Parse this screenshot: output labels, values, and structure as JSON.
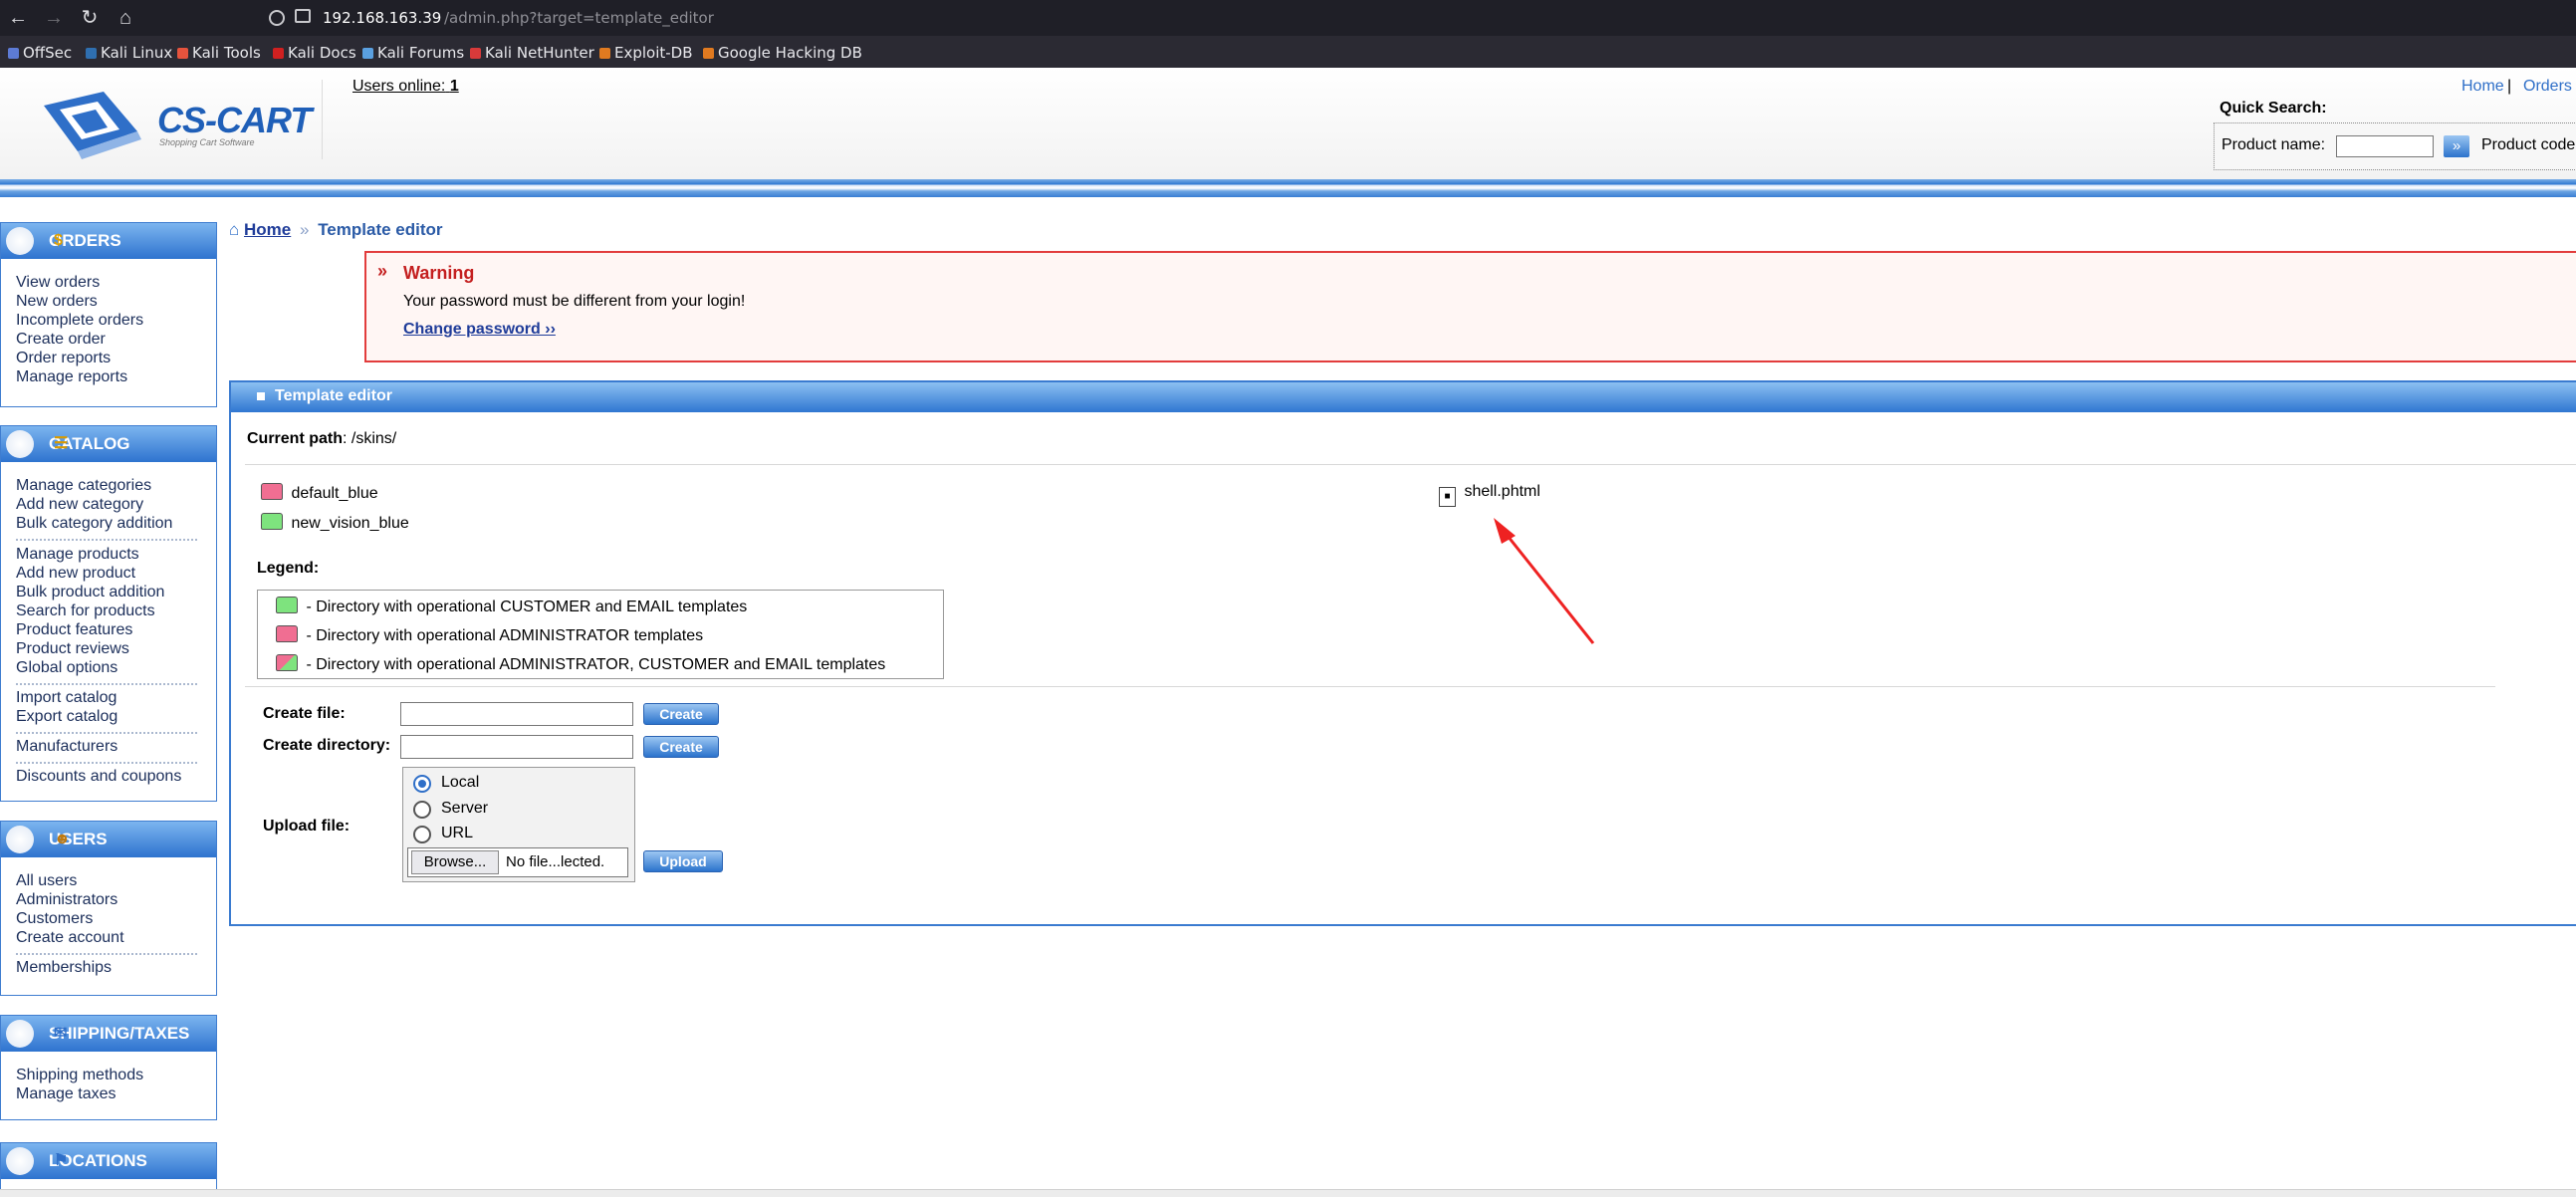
{
  "browser": {
    "url_host": "192.168.163.39",
    "url_path": "/admin.php?target=template_editor",
    "bookmarks": [
      "OffSec",
      "Kali Linux",
      "Kali Tools",
      "Kali Docs",
      "Kali Forums",
      "Kali NetHunter",
      "Exploit-DB",
      "Google Hacking DB"
    ]
  },
  "header": {
    "logo_text": "CS-CART",
    "logo_sub": "Shopping Cart Software",
    "users_online_label": "Users online:",
    "users_online_count": "1",
    "top_links": [
      "Home",
      "|",
      "Orders"
    ],
    "quick_search_title": "Quick Search:",
    "product_name_label": "Product name:",
    "product_code_label": "Product code"
  },
  "sidebar": {
    "orders": {
      "title": "ORDERS",
      "items": [
        "View orders",
        "New orders",
        "Incomplete orders",
        "Create order",
        "Order reports",
        "Manage reports"
      ]
    },
    "catalog": {
      "title": "CATALOG",
      "items": [
        "Manage categories",
        "Add new category",
        "Bulk category addition",
        "Manage products",
        "Add new product",
        "Bulk product addition",
        "Search for products",
        "Product features",
        "Product reviews",
        "Global options",
        "Import catalog",
        "Export catalog",
        "Manufacturers",
        "Discounts and coupons"
      ]
    },
    "users": {
      "title": "USERS",
      "items": [
        "All users",
        "Administrators",
        "Customers",
        "Create account",
        "Memberships"
      ]
    },
    "shipping": {
      "title": "SHIPPING/TAXES",
      "items": [
        "Shipping methods",
        "Manage taxes"
      ]
    },
    "locations": {
      "title": "LOCATIONS"
    }
  },
  "breadcrumb": {
    "home": "Home",
    "current": "Template editor"
  },
  "warning": {
    "title": "Warning",
    "message": "Your password must be different from your login!",
    "link": "Change password ››"
  },
  "editor": {
    "title": "Template editor",
    "current_path_label": "Current path",
    "current_path_value": ": /skins/",
    "dirs": [
      "default_blue",
      "new_vision_blue"
    ],
    "files": [
      "shell.phtml"
    ],
    "legend_title": "Legend:",
    "legend": [
      "- Directory with operational CUSTOMER and EMAIL templates",
      "- Directory with operational ADMINISTRATOR templates",
      "- Directory with operational ADMINISTRATOR, CUSTOMER and EMAIL templates"
    ],
    "create_file_label": "Create file:",
    "create_dir_label": "Create directory:",
    "create_button": "Create",
    "upload_label": "Upload file:",
    "upload_options": [
      "Local",
      "Server",
      "URL"
    ],
    "upload_selected": "Local",
    "browse_label": "Browse...",
    "no_file": "No file...lected.",
    "upload_button": "Upload"
  },
  "colors": {
    "accent": "#2f76d1",
    "warning_red": "#c41f1f",
    "link": "#1f3c99",
    "annotation_arrow": "#ee2222"
  }
}
